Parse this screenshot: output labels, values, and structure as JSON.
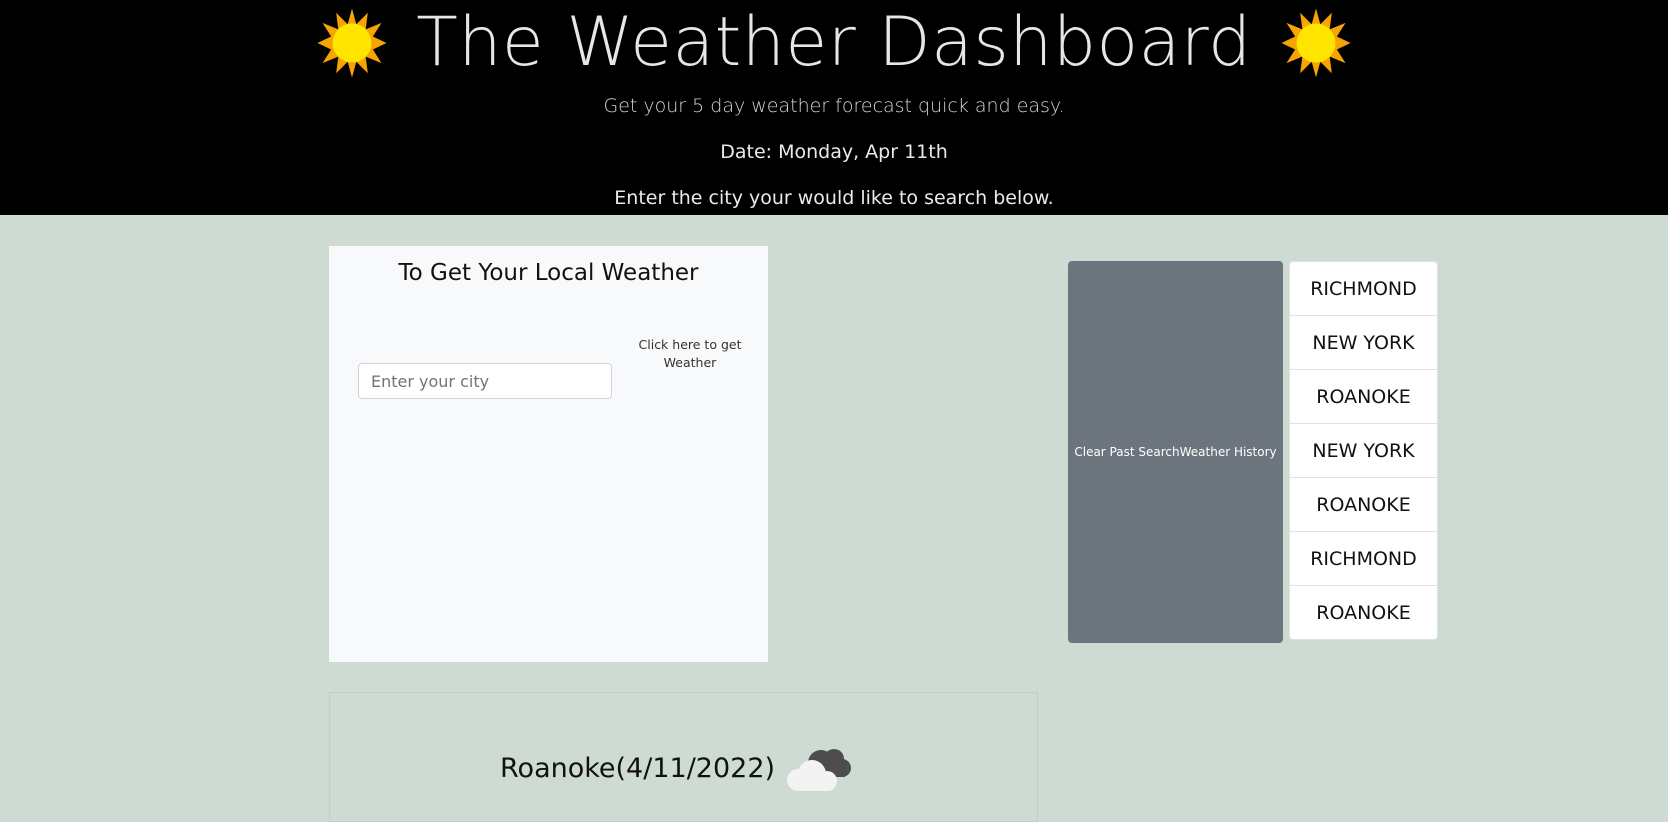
{
  "header": {
    "title": "The Weather Dashboard",
    "subtitle": "Get your 5 day weather forecast quick and easy.",
    "date": "Date: Monday, Apr 11th",
    "prompt": "Enter the city your would like to search below."
  },
  "search": {
    "heading": "To Get Your Local Weather",
    "placeholder": "Enter your city",
    "button_label": "Click here to get Weather"
  },
  "history": {
    "clear_label": "Clear Past SearchWeather History",
    "items": [
      "RICHMOND",
      "NEW YORK",
      "ROANOKE",
      "NEW YORK",
      "ROANOKE",
      "RICHMOND",
      "ROANOKE"
    ]
  },
  "current": {
    "city_date": "Roanoke(4/11/2022)"
  },
  "icons": {
    "header": "sun-icon",
    "current": "cloud-icon"
  },
  "colors": {
    "header_bg": "#000000",
    "page_bg": "#cddbd3",
    "clear_button": "#6c757d"
  }
}
